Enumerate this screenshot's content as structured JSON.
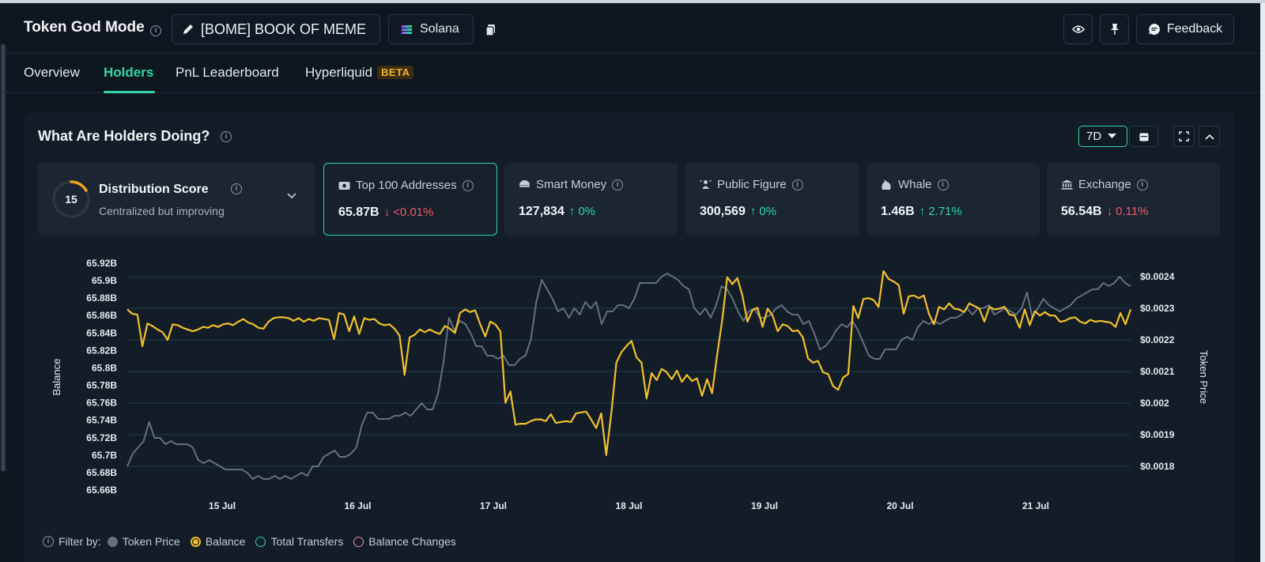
{
  "header": {
    "app_title": "Token God Mode",
    "token_label": "[BOME] BOOK OF MEME",
    "chain_label": "Solana",
    "feedback_label": "Feedback"
  },
  "tabs": [
    {
      "label": "Overview",
      "active": false
    },
    {
      "label": "Holders",
      "active": true
    },
    {
      "label": "PnL Leaderboard",
      "active": false
    },
    {
      "label": "Hyperliquid",
      "active": false,
      "badge": "BETA"
    }
  ],
  "panel": {
    "title": "What Are Holders Doing?",
    "range": "7D"
  },
  "distribution": {
    "score": "15",
    "title": "Distribution Score",
    "subtitle": "Centralized but improving"
  },
  "cards": [
    {
      "label": "Top 100 Addresses",
      "value": "65.87B",
      "change": "<0.01%",
      "direction": "down",
      "icon": "wallet-icon",
      "selected": true
    },
    {
      "label": "Smart Money",
      "value": "127,834",
      "change": "0%",
      "direction": "up",
      "icon": "smart-money-icon",
      "selected": false
    },
    {
      "label": "Public Figure",
      "value": "300,569",
      "change": "0%",
      "direction": "up",
      "icon": "public-figure-icon",
      "selected": false
    },
    {
      "label": "Whale",
      "value": "1.46B",
      "change": "2.71%",
      "direction": "up",
      "icon": "whale-icon",
      "selected": false
    },
    {
      "label": "Exchange",
      "value": "56.54B",
      "change": "0.11%",
      "direction": "down",
      "icon": "bank-icon",
      "selected": false
    }
  ],
  "legend": {
    "filter_label": "Filter by:",
    "items": [
      {
        "label": "Token Price",
        "color": "#64707d",
        "style": "filled"
      },
      {
        "label": "Balance",
        "color": "#f2c02c",
        "style": "ring-filled"
      },
      {
        "label": "Total Transfers",
        "color": "#2fd6a3",
        "style": "ring"
      },
      {
        "label": "Balance Changes",
        "color": "#e88aa6",
        "style": "ring"
      }
    ]
  },
  "chart_data": {
    "type": "line",
    "x_labels": [
      "15 Jul",
      "16 Jul",
      "17 Jul",
      "18 Jul",
      "19 Jul",
      "20 Jul",
      "21 Jul"
    ],
    "x_range_days": [
      14.3,
      21.7
    ],
    "left_axis": {
      "label": "Balance",
      "ticks": [
        "65.92B",
        "65.9B",
        "65.88B",
        "65.86B",
        "65.84B",
        "65.82B",
        "65.8B",
        "65.78B",
        "65.76B",
        "65.74B",
        "65.72B",
        "65.7B",
        "65.68B",
        "65.66B"
      ],
      "range": [
        65.66,
        65.92
      ]
    },
    "right_axis": {
      "label": "Token Price",
      "ticks": [
        "$0.0024",
        "$0.0023",
        "$0.0022",
        "$0.0021",
        "$0.002",
        "$0.0019",
        "$0.0018"
      ],
      "range": [
        0.0018,
        0.0024
      ]
    },
    "grid": true,
    "series": [
      {
        "name": "Balance",
        "color": "#f2c02c",
        "axis": "left",
        "values": [
          65.867,
          65.862,
          65.861,
          65.825,
          65.851,
          65.848,
          65.844,
          65.841,
          65.832,
          65.85,
          65.849,
          65.846,
          65.844,
          65.842,
          65.844,
          65.847,
          65.846,
          65.849,
          65.847,
          65.85,
          65.851,
          65.849,
          65.853,
          65.856,
          65.852,
          65.85,
          65.846,
          65.845,
          65.853,
          65.857,
          65.858,
          65.858,
          65.857,
          65.854,
          65.857,
          65.853,
          65.856,
          65.854,
          65.857,
          65.856,
          65.855,
          65.833,
          65.863,
          65.861,
          65.842,
          65.859,
          65.839,
          65.857,
          65.855,
          65.856,
          65.851,
          65.849,
          65.85,
          65.845,
          65.837,
          65.792,
          65.835,
          65.838,
          65.844,
          65.841,
          65.844,
          65.841,
          65.839,
          65.848,
          65.845,
          65.84,
          65.863,
          65.867,
          65.864,
          65.866,
          65.85,
          65.836,
          65.853,
          65.85,
          65.842,
          65.76,
          65.773,
          65.735,
          65.736,
          65.736,
          65.739,
          65.741,
          65.741,
          65.739,
          65.747,
          65.737,
          65.738,
          65.739,
          65.738,
          65.748,
          65.749,
          65.75,
          65.741,
          65.731,
          65.748,
          65.7,
          65.748,
          65.806,
          65.818,
          65.825,
          65.831,
          65.812,
          65.806,
          65.765,
          65.794,
          65.786,
          65.799,
          65.795,
          65.787,
          65.797,
          65.784,
          65.792,
          65.785,
          65.788,
          65.768,
          65.787,
          65.771,
          65.815,
          65.855,
          65.904,
          65.896,
          65.903,
          65.883,
          65.853,
          65.866,
          65.869,
          65.847,
          65.868,
          65.86,
          65.842,
          65.85,
          65.848,
          65.842,
          65.843,
          65.835,
          65.811,
          65.806,
          65.808,
          65.795,
          65.793,
          65.779,
          65.775,
          65.789,
          65.793,
          65.871,
          65.857,
          65.879,
          65.88,
          65.878,
          65.87,
          65.911,
          65.902,
          65.899,
          65.895,
          65.862,
          65.882,
          65.883,
          65.88,
          65.883,
          65.862,
          65.85,
          65.87,
          65.867,
          65.874,
          65.868,
          65.867,
          65.864,
          65.874,
          65.871,
          65.868,
          65.853,
          65.87,
          65.867,
          65.868,
          65.87,
          65.861,
          65.86,
          65.846,
          65.867,
          65.849,
          65.865,
          65.86,
          65.864,
          65.86,
          65.86,
          65.853,
          65.854,
          65.857,
          65.858,
          65.853,
          65.851,
          65.855,
          65.853,
          65.854,
          65.853,
          65.852,
          65.847,
          65.863,
          65.85,
          65.867
        ]
      },
      {
        "name": "Token Price",
        "color": "#64707d",
        "axis": "right",
        "values": [
          0.0018,
          0.00184,
          0.00186,
          0.00188,
          0.00194,
          0.00189,
          0.00189,
          0.00187,
          0.00188,
          0.00187,
          0.00187,
          0.00187,
          0.00186,
          0.00182,
          0.00181,
          0.00182,
          0.00181,
          0.0018,
          0.00179,
          0.00179,
          0.00179,
          0.00179,
          0.00178,
          0.00176,
          0.00177,
          0.00176,
          0.00176,
          0.00177,
          0.00176,
          0.00177,
          0.00176,
          0.00177,
          0.00178,
          0.00177,
          0.0018,
          0.0018,
          0.00183,
          0.00184,
          0.00185,
          0.00183,
          0.00183,
          0.00184,
          0.00186,
          0.00193,
          0.00197,
          0.00197,
          0.00195,
          0.00195,
          0.00195,
          0.00196,
          0.00196,
          0.00197,
          0.00196,
          0.00198,
          0.002,
          0.00198,
          0.00198,
          0.00203,
          0.00213,
          0.00227,
          0.00223,
          0.00226,
          0.00225,
          0.00222,
          0.00218,
          0.00218,
          0.00215,
          0.00215,
          0.00214,
          0.00215,
          0.00212,
          0.00212,
          0.00214,
          0.00215,
          0.0022,
          0.00232,
          0.00239,
          0.00236,
          0.00233,
          0.00229,
          0.0023,
          0.00227,
          0.0023,
          0.00228,
          0.00232,
          0.0023,
          0.00232,
          0.00225,
          0.00229,
          0.00229,
          0.00231,
          0.00231,
          0.0023,
          0.00233,
          0.00238,
          0.00238,
          0.00238,
          0.00238,
          0.0024,
          0.00241,
          0.0024,
          0.00239,
          0.00237,
          0.00236,
          0.0023,
          0.00228,
          0.0023,
          0.00227,
          0.00231,
          0.00237,
          0.00236,
          0.00233,
          0.00229,
          0.00226,
          0.00229,
          0.0023,
          0.00227,
          0.00227,
          0.00228,
          0.0023,
          0.00231,
          0.00229,
          0.00228,
          0.00228,
          0.00225,
          0.00226,
          0.00222,
          0.00217,
          0.00218,
          0.0022,
          0.00223,
          0.00225,
          0.00224,
          0.00226,
          0.00223,
          0.00219,
          0.00215,
          0.00214,
          0.00214,
          0.00217,
          0.00217,
          0.00217,
          0.0022,
          0.00221,
          0.0022,
          0.00224,
          0.00226,
          0.00225,
          0.00226,
          0.00225,
          0.00226,
          0.00227,
          0.00227,
          0.00228,
          0.0023,
          0.00228,
          0.0023,
          0.0023,
          0.00231,
          0.00228,
          0.00229,
          0.0023,
          0.00229,
          0.00228,
          0.0023,
          0.00235,
          0.00227,
          0.0023,
          0.00233,
          0.00231,
          0.0023,
          0.00229,
          0.0023,
          0.00231,
          0.00233,
          0.00234,
          0.00235,
          0.00236,
          0.00236,
          0.00238,
          0.00237,
          0.00238,
          0.0024,
          0.00238,
          0.00237
        ]
      }
    ]
  }
}
